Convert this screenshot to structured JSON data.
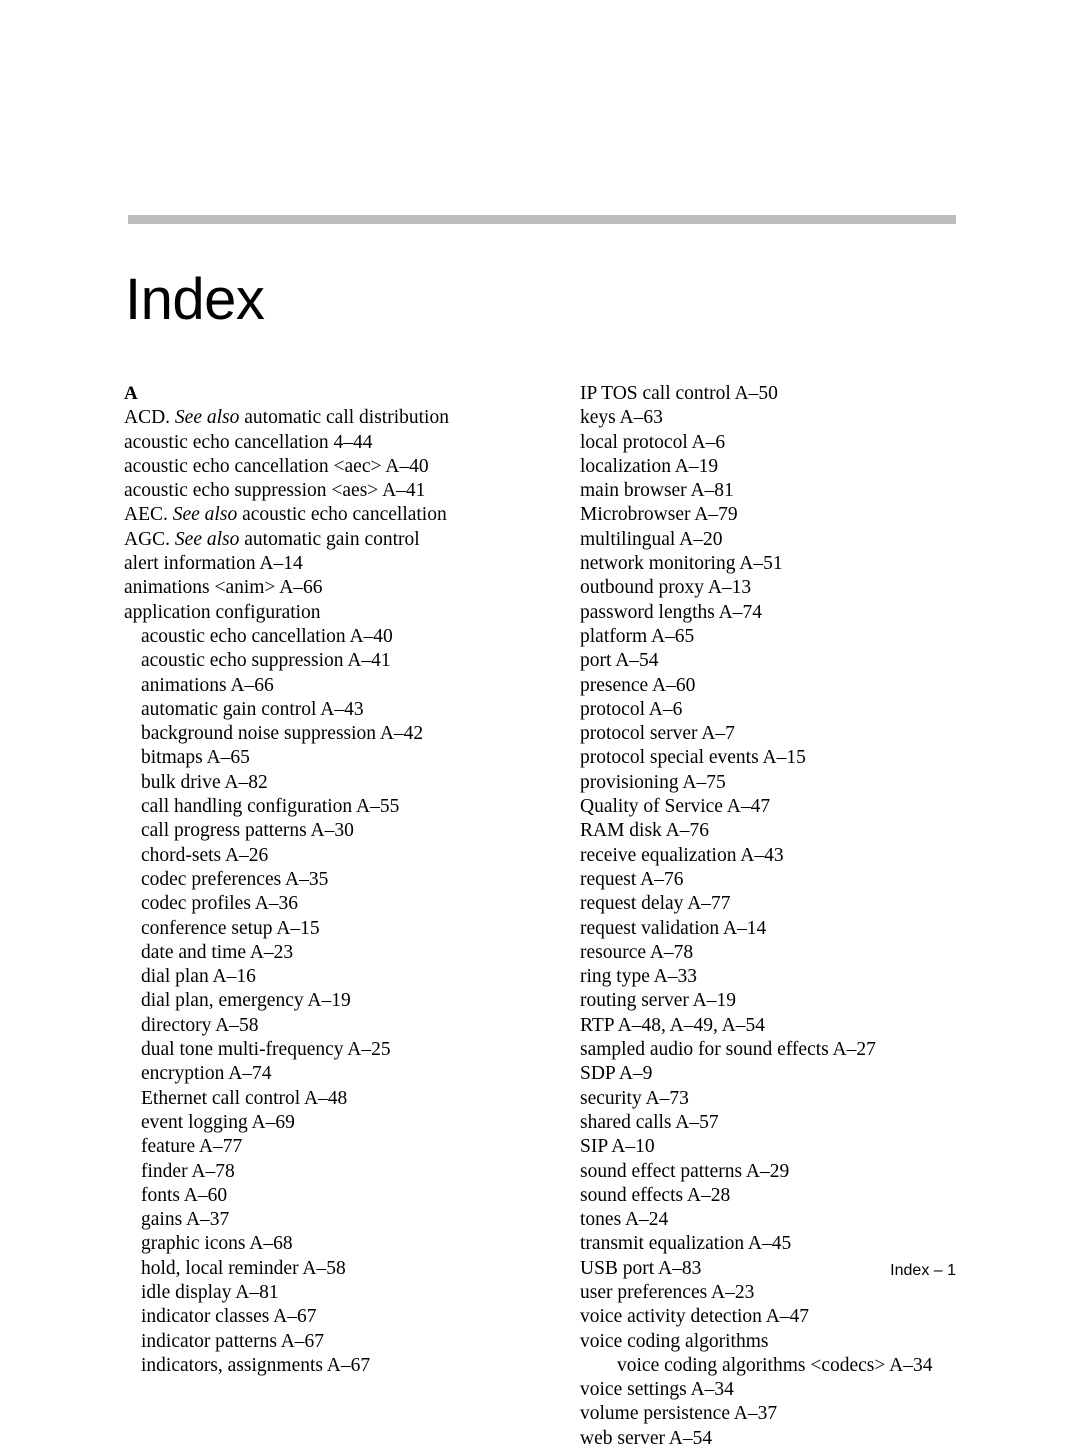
{
  "document": {
    "title": "Index",
    "footer": "Index – 1",
    "rule_color": "#bdbdbd"
  },
  "columns": {
    "left": [
      {
        "level": 0,
        "heading": true,
        "text": "A"
      },
      {
        "level": 0,
        "pre": "ACD.  ",
        "italic": "See also",
        "post": " automatic call distribution"
      },
      {
        "level": 0,
        "text": "acoustic echo cancellation 4–44"
      },
      {
        "level": 0,
        "text": "acoustic echo cancellation <aec> A–40"
      },
      {
        "level": 0,
        "text": "acoustic echo suppression <aes> A–41"
      },
      {
        "level": 0,
        "pre": "AEC.  ",
        "italic": "See also",
        "post": " acoustic echo cancellation"
      },
      {
        "level": 0,
        "pre": "AGC.  ",
        "italic": "See also",
        "post": "  automatic gain control"
      },
      {
        "level": 0,
        "text": "alert information A–14"
      },
      {
        "level": 0,
        "text": "animations <anim> A–66"
      },
      {
        "level": 0,
        "text": "application configuration"
      },
      {
        "level": 1,
        "text": "acoustic echo cancellation A–40"
      },
      {
        "level": 1,
        "text": "acoustic echo suppression A–41"
      },
      {
        "level": 1,
        "text": "animations A–66"
      },
      {
        "level": 1,
        "text": "automatic gain control A–43"
      },
      {
        "level": 1,
        "text": "background noise suppression A–42"
      },
      {
        "level": 1,
        "text": "bitmaps A–65"
      },
      {
        "level": 1,
        "text": "bulk drive A–82"
      },
      {
        "level": 1,
        "text": "call handling configuration A–55"
      },
      {
        "level": 1,
        "text": "call progress patterns A–30"
      },
      {
        "level": 1,
        "text": "chord-sets A–26"
      },
      {
        "level": 1,
        "text": "codec preferences A–35"
      },
      {
        "level": 1,
        "text": "codec profiles A–36"
      },
      {
        "level": 1,
        "text": "conference setup A–15"
      },
      {
        "level": 1,
        "text": "date and time A–23"
      },
      {
        "level": 1,
        "text": "dial plan A–16"
      },
      {
        "level": 1,
        "text": "dial plan, emergency A–19"
      },
      {
        "level": 1,
        "text": "directory A–58"
      },
      {
        "level": 1,
        "text": "dual tone multi-frequency A–25"
      },
      {
        "level": 1,
        "text": "encryption A–74"
      },
      {
        "level": 1,
        "text": "Ethernet call control A–48"
      },
      {
        "level": 1,
        "text": "event logging A–69"
      },
      {
        "level": 1,
        "text": "feature A–77"
      },
      {
        "level": 1,
        "text": "finder A–78"
      },
      {
        "level": 1,
        "text": "fonts A–60"
      },
      {
        "level": 1,
        "text": "gains A–37"
      },
      {
        "level": 1,
        "text": "graphic icons A–68"
      },
      {
        "level": 1,
        "text": "hold, local reminder A–58"
      },
      {
        "level": 1,
        "text": "idle display A–81"
      },
      {
        "level": 1,
        "text": "indicator classes A–67"
      },
      {
        "level": 1,
        "text": "indicator patterns A–67"
      },
      {
        "level": 1,
        "text": "indicators, assignments A–67"
      }
    ],
    "right": [
      {
        "level": 0,
        "text": "IP TOS call control A–50"
      },
      {
        "level": 0,
        "text": "keys A–63"
      },
      {
        "level": 0,
        "text": "local protocol A–6"
      },
      {
        "level": 0,
        "text": "localization A–19"
      },
      {
        "level": 0,
        "text": "main browser A–81"
      },
      {
        "level": 0,
        "text": "Microbrowser A–79"
      },
      {
        "level": 0,
        "text": "multilingual A–20"
      },
      {
        "level": 0,
        "text": "network monitoring A–51"
      },
      {
        "level": 0,
        "text": "outbound proxy A–13"
      },
      {
        "level": 0,
        "text": "password lengths A–74"
      },
      {
        "level": 0,
        "text": "platform A–65"
      },
      {
        "level": 0,
        "text": "port A–54"
      },
      {
        "level": 0,
        "text": "presence A–60"
      },
      {
        "level": 0,
        "text": "protocol A–6"
      },
      {
        "level": 0,
        "text": "protocol server A–7"
      },
      {
        "level": 0,
        "text": "protocol special events A–15"
      },
      {
        "level": 0,
        "text": "provisioning A–75"
      },
      {
        "level": 0,
        "text": "Quality of Service A–47"
      },
      {
        "level": 0,
        "text": "RAM disk A–76"
      },
      {
        "level": 0,
        "text": "receive equalization A–43"
      },
      {
        "level": 0,
        "text": "request A–76"
      },
      {
        "level": 0,
        "text": "request delay A–77"
      },
      {
        "level": 0,
        "text": "request validation A–14"
      },
      {
        "level": 0,
        "text": "resource A–78"
      },
      {
        "level": 0,
        "text": "ring type A–33"
      },
      {
        "level": 0,
        "text": "routing server A–19"
      },
      {
        "level": 0,
        "text": "RTP A–48, A–49, A–54"
      },
      {
        "level": 0,
        "text": "sampled audio for sound effects A–27"
      },
      {
        "level": 0,
        "text": "SDP A–9"
      },
      {
        "level": 0,
        "text": "security A–73"
      },
      {
        "level": 0,
        "text": "shared calls A–57"
      },
      {
        "level": 0,
        "text": "SIP A–10"
      },
      {
        "level": 0,
        "text": "sound effect patterns A–29"
      },
      {
        "level": 0,
        "text": "sound effects A–28"
      },
      {
        "level": 0,
        "text": "tones A–24"
      },
      {
        "level": 0,
        "text": "transmit equalization A–45"
      },
      {
        "level": 0,
        "text": "USB port A–83"
      },
      {
        "level": 0,
        "text": "user preferences A–23"
      },
      {
        "level": 0,
        "text": "voice activity detection A–47"
      },
      {
        "level": 0,
        "text": "voice coding algorithms"
      },
      {
        "level": 2,
        "text": "voice coding algorithms <codecs> A–34"
      },
      {
        "level": 0,
        "text": "voice settings A–34"
      },
      {
        "level": 0,
        "text": "volume persistence A–37"
      },
      {
        "level": 0,
        "text": "web server A–54"
      }
    ]
  }
}
